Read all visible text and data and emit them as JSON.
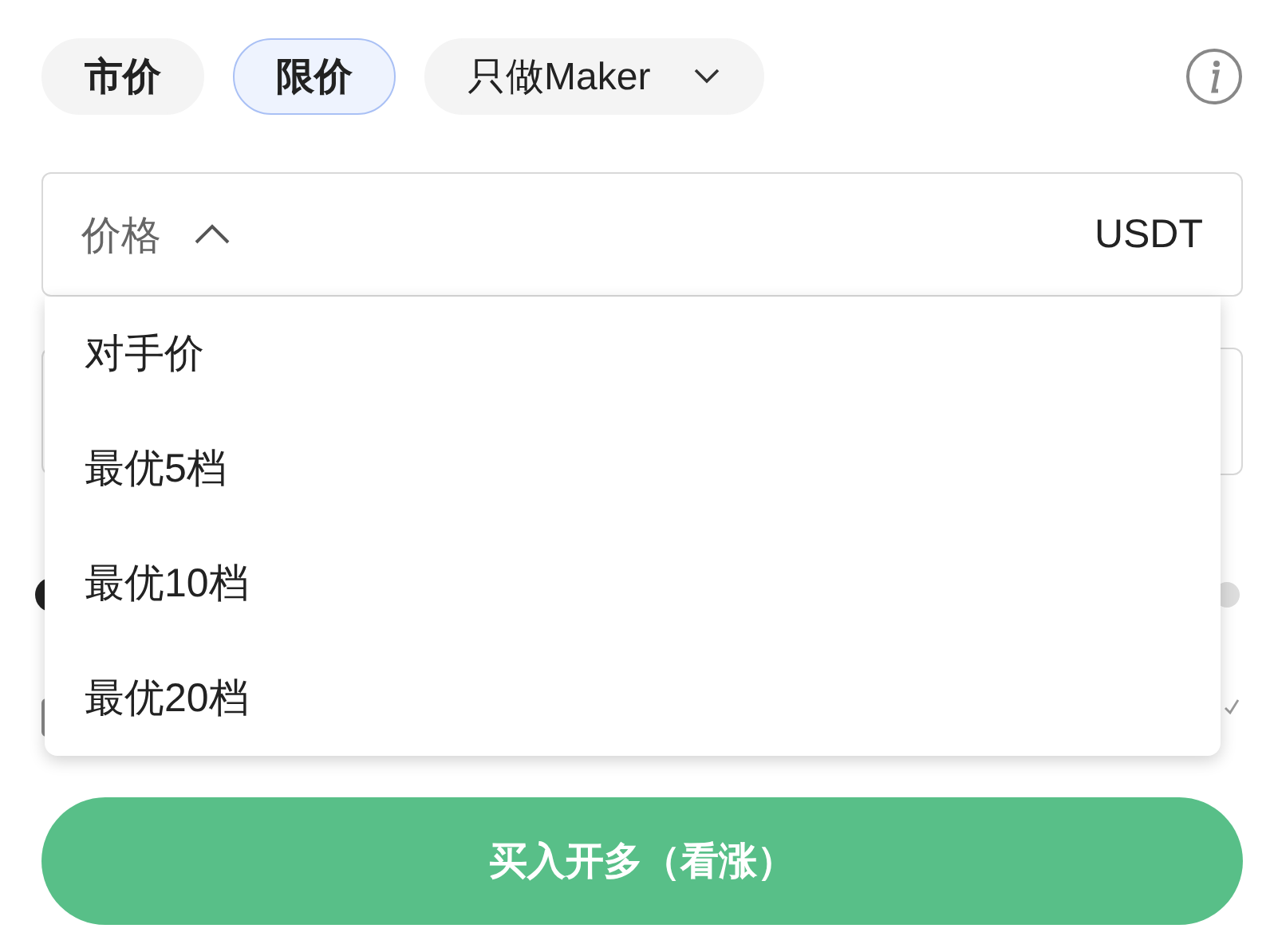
{
  "order_types": [
    {
      "label": "市价",
      "selected": false,
      "kind": "plain"
    },
    {
      "label": "限价",
      "selected": true,
      "kind": "plain"
    },
    {
      "label": "只做Maker",
      "selected": false,
      "kind": "dropdown"
    }
  ],
  "price_field": {
    "label": "价格",
    "unit": "USDT",
    "expanded": true
  },
  "price_menu": {
    "items": [
      {
        "label": "对手价"
      },
      {
        "label": "最优5档"
      },
      {
        "label": "最优10档"
      },
      {
        "label": "最优20档"
      }
    ]
  },
  "submit_button": {
    "label": "买入开多（看涨）"
  }
}
